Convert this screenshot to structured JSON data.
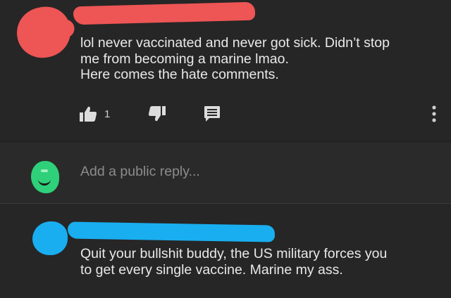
{
  "comments": [
    {
      "text_lines": [
        "lol never vaccinated and never got sick. Didn’t stop",
        "me from becoming a marine lmao.",
        "Here comes the hate comments."
      ],
      "like_count": "1",
      "avatar_color": "#ee5555",
      "redaction_color": "#ee5555"
    },
    {
      "text_lines": [
        "Quit your bullshit buddy, the US military forces you",
        "to get every single vaccine. Marine my ass."
      ],
      "avatar_color": "#19aef0",
      "redaction_color": "#19aef0"
    }
  ],
  "reply_box": {
    "placeholder": "Add a public reply...",
    "avatar_color": "#2fd07a"
  },
  "icons": {
    "like": "thumbs-up-icon",
    "dislike": "thumbs-down-icon",
    "reply": "comment-icon",
    "more": "more-vertical-icon"
  },
  "colors": {
    "background": "#242424",
    "text": "#e9e9e9",
    "placeholder": "#8c8c8c"
  }
}
